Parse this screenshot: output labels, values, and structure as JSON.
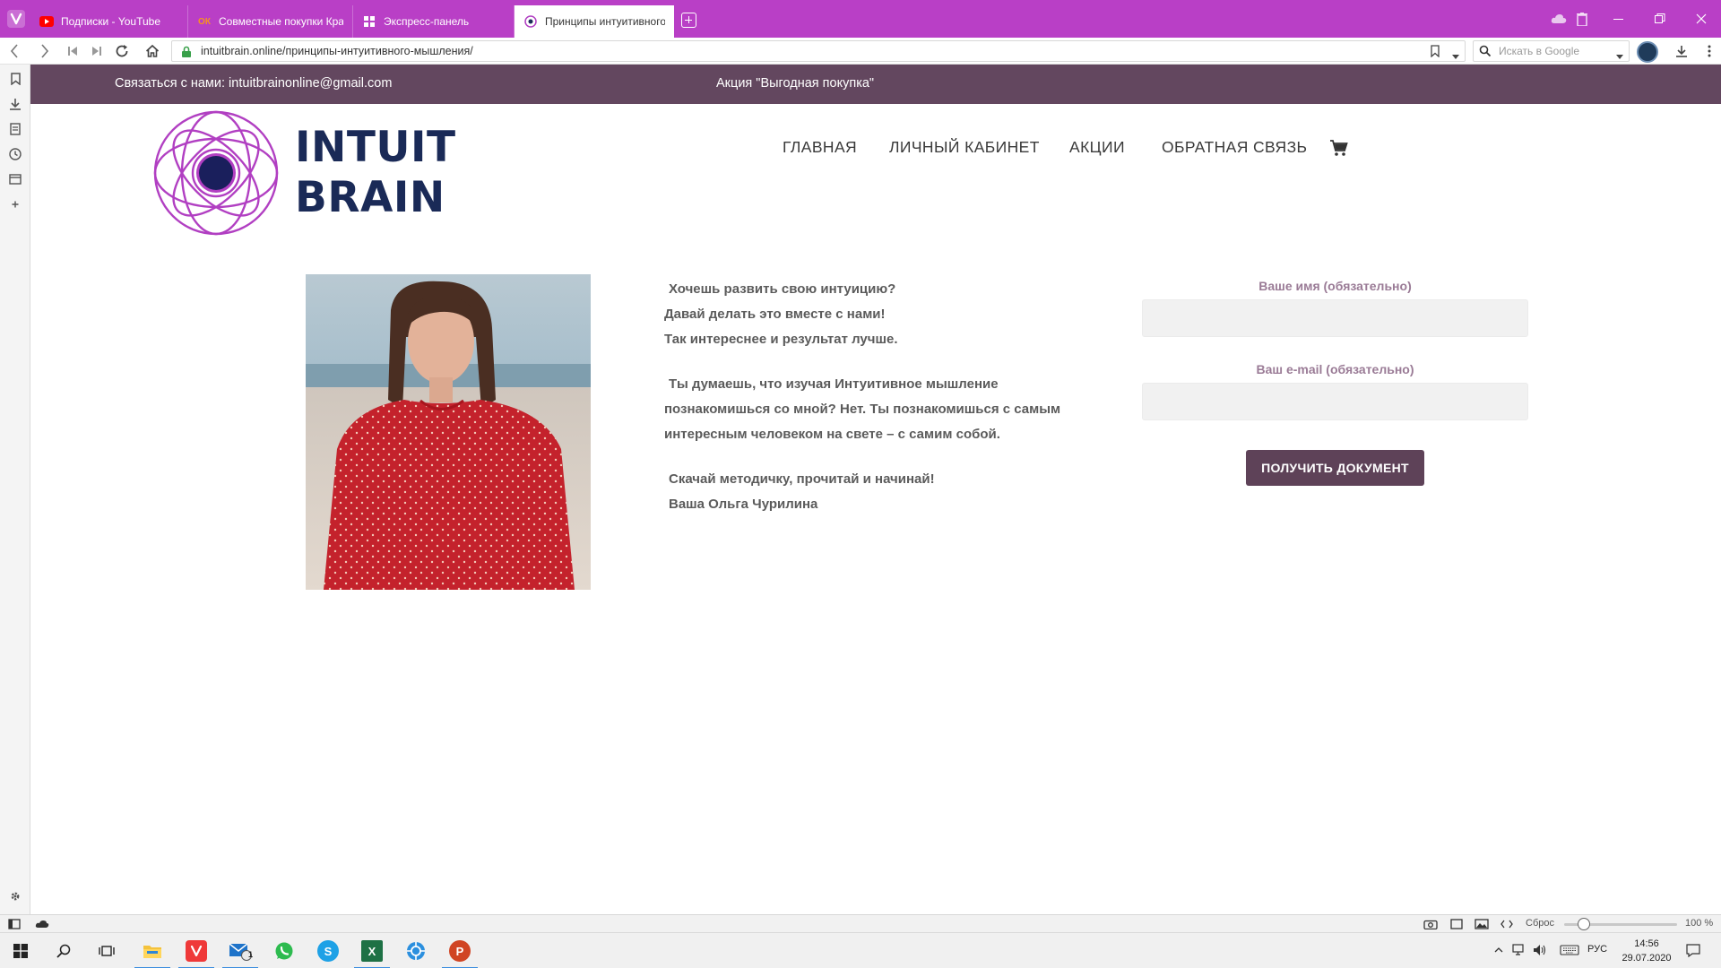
{
  "browser": {
    "tabs": [
      {
        "label": "Подписки - YouTube",
        "icon": "youtube-icon",
        "active": false
      },
      {
        "label": "Совместные покупки Крас",
        "icon": "odnoklassniki-icon",
        "active": false
      },
      {
        "label": "Экспресс-панель",
        "icon": "speed-dial-icon",
        "active": false
      },
      {
        "label": "Принципы интуитивного",
        "icon": "intuitbrain-favicon",
        "active": true
      }
    ],
    "address": {
      "url": "intuitbrain.online/принципы-интуитивного-мышления/"
    },
    "search": {
      "placeholder": "Искать в Google"
    },
    "status": {
      "reset_label": "Сброс",
      "zoom": "100 %",
      "zoom_fraction": 1.0
    }
  },
  "site": {
    "topbar": {
      "contact": "Связаться с нами: intuitbrainonline@gmail.com",
      "promo": "Акция \"Выгодная покупка\""
    },
    "logo": {
      "line1": "INTUIT",
      "line2": "BRAIN"
    },
    "nav": [
      "ГЛАВНАЯ",
      "ЛИЧНЫЙ КАБИНЕТ",
      "АКЦИИ",
      "ОБРАТНАЯ СВЯЗЬ"
    ],
    "article": {
      "p1": [
        " Хочешь развить свою интуицию?",
        "Давай делать это вместе с нами!",
        "Так интереснее и результат лучше."
      ],
      "p2": [
        " Ты думаешь, что изучая Интуитивное мышление",
        "познакомишься со мной? Нет. Ты познакомишься с самым",
        "интересным человеком на свете – с самим собой."
      ],
      "p3": [
        " Скачай методичку, прочитай и начинай!",
        " Ваша Ольга Чурилина"
      ]
    },
    "form": {
      "name_label": "Ваше имя (обязательно)",
      "name_value": "",
      "email_label": "Ваш e-mail (обязательно)",
      "email_value": "",
      "submit": "ПОЛУЧИТЬ ДОКУМЕНТ"
    }
  },
  "taskbar": {
    "apps": [
      "windows-start-icon",
      "search-icon",
      "task-view-icon",
      "file-explorer-icon",
      "vivaldi-icon",
      "mail-icon",
      "whatsapp-icon",
      "skype-icon",
      "excel-icon",
      "app-icon",
      "powerpoint-icon"
    ],
    "mail_badge": "1",
    "lang": "РУС",
    "time": "14:56",
    "date": "29.07.2020"
  },
  "colors": {
    "browser_accent": "#b93fc6",
    "site_bar": "#63475f",
    "logo_ring": "#b13fc2",
    "logo_text": "#1a2a57",
    "form_label": "#9a7b96",
    "button": "#5e4258"
  }
}
